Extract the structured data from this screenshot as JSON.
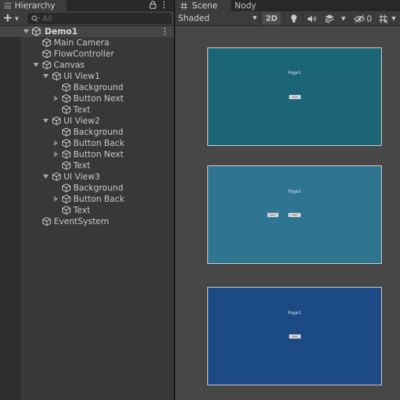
{
  "hierarchy": {
    "tab_label": "Hierarchy",
    "search": {
      "placeholder": "All"
    },
    "scene_name": "Demo1",
    "items": [
      {
        "label": "Main Camera"
      },
      {
        "label": "FlowController"
      },
      {
        "label": "Canvas"
      },
      {
        "label": "UI View1"
      },
      {
        "label": "Background"
      },
      {
        "label": "Button Next"
      },
      {
        "label": "Text"
      },
      {
        "label": "UI View2"
      },
      {
        "label": "Background"
      },
      {
        "label": "Button Back"
      },
      {
        "label": "Button Next"
      },
      {
        "label": "Text"
      },
      {
        "label": "UI View3"
      },
      {
        "label": "Background"
      },
      {
        "label": "Button Back"
      },
      {
        "label": "Text"
      },
      {
        "label": "EventSystem"
      }
    ]
  },
  "scene_view": {
    "tabs": [
      {
        "label": "Scene"
      },
      {
        "label": "Nody"
      }
    ],
    "shading_mode": "Shaded",
    "toggle_2d_label": "2D",
    "hidden_count": "0",
    "pages": [
      {
        "title": "Page1",
        "color": "#1c6577",
        "buttons": [
          "Next"
        ]
      },
      {
        "title": "Page2",
        "color": "#2f7491",
        "buttons": [
          "Back",
          "Next"
        ]
      },
      {
        "title": "Page3",
        "color": "#1c4a85",
        "buttons": [
          "Back"
        ]
      }
    ]
  },
  "colors": {
    "panel_bg": "#383838",
    "toolbar_bg": "#3c3c3c",
    "scene_bg": "#474747",
    "text": "#c8c8c8"
  }
}
